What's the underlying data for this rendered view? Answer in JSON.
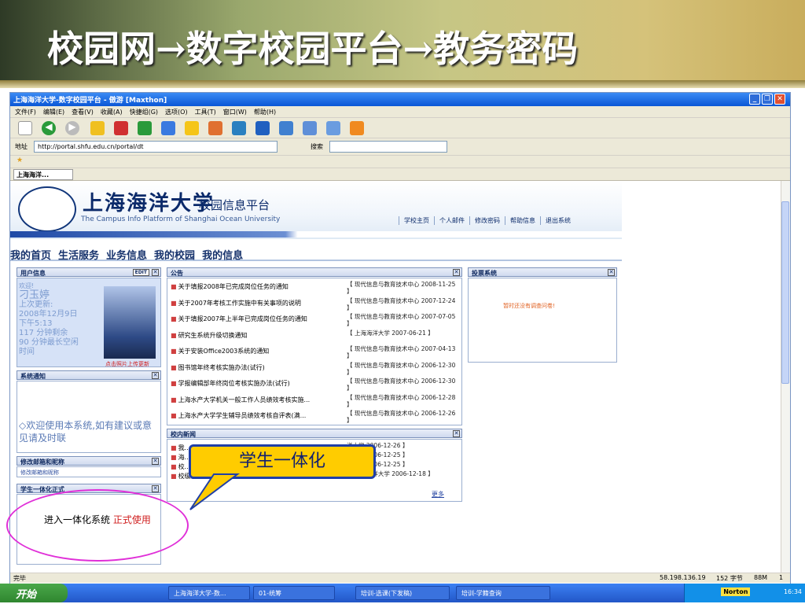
{
  "slide": {
    "title": "校园网→数字校园平台→教务密码"
  },
  "window": {
    "title": "上海海洋大学-数字校园平台 - 傲游 [Maxthon]"
  },
  "menu": [
    "文件(F)",
    "编辑(E)",
    "查看(V)",
    "收藏(A)",
    "快捷组(G)",
    "选项(O)",
    "工具(T)",
    "窗口(W)",
    "帮助(H)"
  ],
  "address": {
    "label": "地址",
    "url": "http://portal.shfu.edu.cn/portal/dt",
    "search_label": "搜索"
  },
  "tab": {
    "label": "上海海洋..."
  },
  "portal": {
    "uni_name": "上海海洋大学",
    "platform": "校园信息平台",
    "platform_en": "The Campus Info Platform of Shanghai Ocean University",
    "top_links": [
      "学校主页",
      "个人邮件",
      "修改密码",
      "帮助信息",
      "退出系统"
    ],
    "nav": [
      "我的首页",
      "生活服务",
      "业务信息",
      "我的校园",
      "我的信息"
    ]
  },
  "userinfo": {
    "title": "用户信息",
    "edit": "EDIT",
    "lines": [
      "欢迎!",
      "刁玉婷",
      "上次更新:",
      "2008年12月9日",
      "下午5:13",
      "117 分钟剩余",
      "90 分钟最长空闲",
      "时间"
    ],
    "upload": "点击照片上传更新"
  },
  "sysnotice": {
    "title": "系统通知",
    "text": "◇欢迎使用本系统,如有建议或意见请及时联"
  },
  "mailbox": {
    "title": "修改邮箱和昵称",
    "link": "修改邮箱和昵称"
  },
  "integration": {
    "title": "学生一体化正式",
    "text": "进入一体化系统",
    "link": "正式使用"
  },
  "notice": {
    "title": "公告",
    "items": [
      {
        "t": "关于填报2008年已完成岗位任务的通知",
        "s": "【 现代信息与教育技术中心 2008-11-25 】"
      },
      {
        "t": "关于2007年考核工作实施中有关事项的说明",
        "s": "【 现代信息与教育技术中心 2007-12-24 】"
      },
      {
        "t": "关于填报2007年上半年已完成岗位任务的通知",
        "s": "【 现代信息与教育技术中心 2007-07-05 】"
      },
      {
        "t": "研究生系统升级切换通知",
        "s": "【 上海海洋大学 2007-06-21 】"
      },
      {
        "t": "关于安装Office2003系统的通知",
        "s": "【 现代信息与教育技术中心 2007-04-13 】"
      },
      {
        "t": "图书馆年终考核实施办法(试行)",
        "s": "【 现代信息与教育技术中心 2006-12-30 】"
      },
      {
        "t": "学报编辑部年终岗位考核实施办法(试行)",
        "s": "【 现代信息与教育技术中心 2006-12-30 】"
      },
      {
        "t": "上海水产大学机关一般工作人员绩效考核实施...",
        "s": "【 现代信息与教育技术中心 2006-12-28 】"
      },
      {
        "t": "上海水产大学学生辅导员绩效考核自评表(满...",
        "s": "【 现代信息与教育技术中心 2006-12-26 】"
      }
    ]
  },
  "vote": {
    "title": "投票系统",
    "empty": "暂时还没有调查问卷!"
  },
  "news": {
    "title": "校内新闻",
    "items": [
      {
        "t": "我...",
        "s": "洋大学 2006-12-26 】"
      },
      {
        "t": "海...",
        "s": "洋大学 2006-12-25 】"
      },
      {
        "t": "校...",
        "s": "洋大学 2006-12-25 】"
      },
      {
        "t": "校级学位...",
        "s": "【 上海海洋大学 2006-12-18 】"
      }
    ],
    "more": "更多"
  },
  "callout": "学生一体化",
  "status": {
    "left": "完毕",
    "ip": "58.198.136.19",
    "bytes": "152 字节",
    "mem": "88M",
    "n": "1"
  },
  "taskbar": {
    "start": "开始",
    "tasks": [
      "上海海洋大学-数...",
      "01-统筹",
      "培训-选课(下发稿)",
      "培训-学籍查询"
    ],
    "norton": "Norton",
    "clock": "16:34"
  },
  "colors": {
    "accent": "#0a56d6",
    "callout": "#ffcc00",
    "highlight": "#e030d8"
  }
}
